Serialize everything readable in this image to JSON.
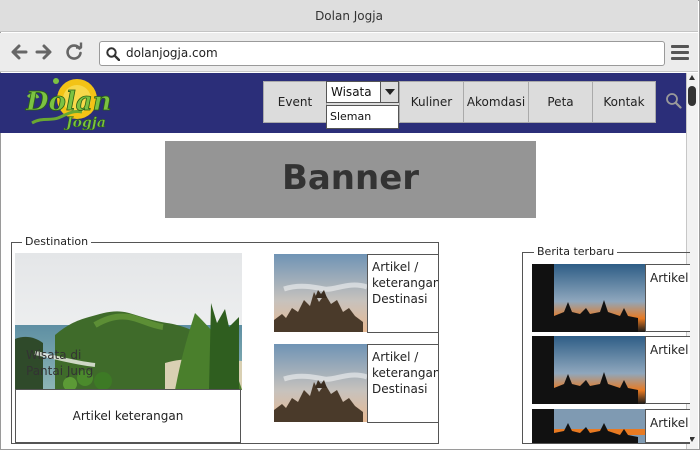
{
  "browser": {
    "title": "Dolan Jogja",
    "url": "dolanjogja.com",
    "icons": [
      "back-arrow-icon",
      "forward-arrow-icon",
      "reload-icon",
      "search-icon",
      "hamburger-menu-icon"
    ]
  },
  "header": {
    "logo_text_main": "Dolan",
    "logo_text_sub": "Jogja",
    "nav": {
      "event": "Event",
      "wisata": "Wisata",
      "wisata_option": "Sleman",
      "kuliner": "Kuliner",
      "akomodasi": "Akomdasi",
      "peta": "Peta",
      "kontak": "Kontak"
    },
    "colors": {
      "header_bg": "#2b2e79",
      "nav_bg": "#dcdcdc"
    }
  },
  "banner": {
    "label": "Banner"
  },
  "destination": {
    "legend": "Destination",
    "main": {
      "caption_line1": "Wisata di",
      "caption_line2": "Pantai Jung",
      "article": "Artikel keterangan"
    },
    "cards": [
      {
        "text": "Artikel / keterangan Destinasi"
      },
      {
        "text": "Artikel / keterangan Destinasi"
      }
    ]
  },
  "berita": {
    "legend": "Berita terbaru",
    "items": [
      {
        "text": "Artikel"
      },
      {
        "text": "Artikel"
      },
      {
        "text": "Artikel"
      }
    ]
  }
}
